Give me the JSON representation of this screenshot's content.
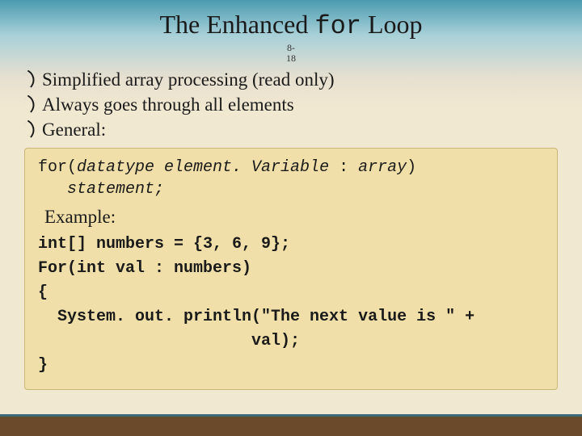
{
  "title": {
    "pre": "The Enhanced ",
    "code": "for",
    "post": " Loop"
  },
  "page": {
    "top": "8-",
    "bot": "18"
  },
  "bullets": {
    "b1": "Simplified array processing (read only)",
    "b2": "Always goes through all elements",
    "b3": "General:"
  },
  "syntax": {
    "line1_pre": "for(",
    "line1_dt": "datatype element. Variable",
    "line1_mid": " : ",
    "line1_arr": "array",
    "line1_post": ")",
    "line2": "statement;"
  },
  "example_label": "Example:",
  "code": {
    "l1": "int[] numbers = {3, 6, 9};",
    "l2": "For(int val : numbers)",
    "l3": "{",
    "l4": "  System. out. println(\"The next value is \" +",
    "l5": "                      val);",
    "l6": "}"
  }
}
